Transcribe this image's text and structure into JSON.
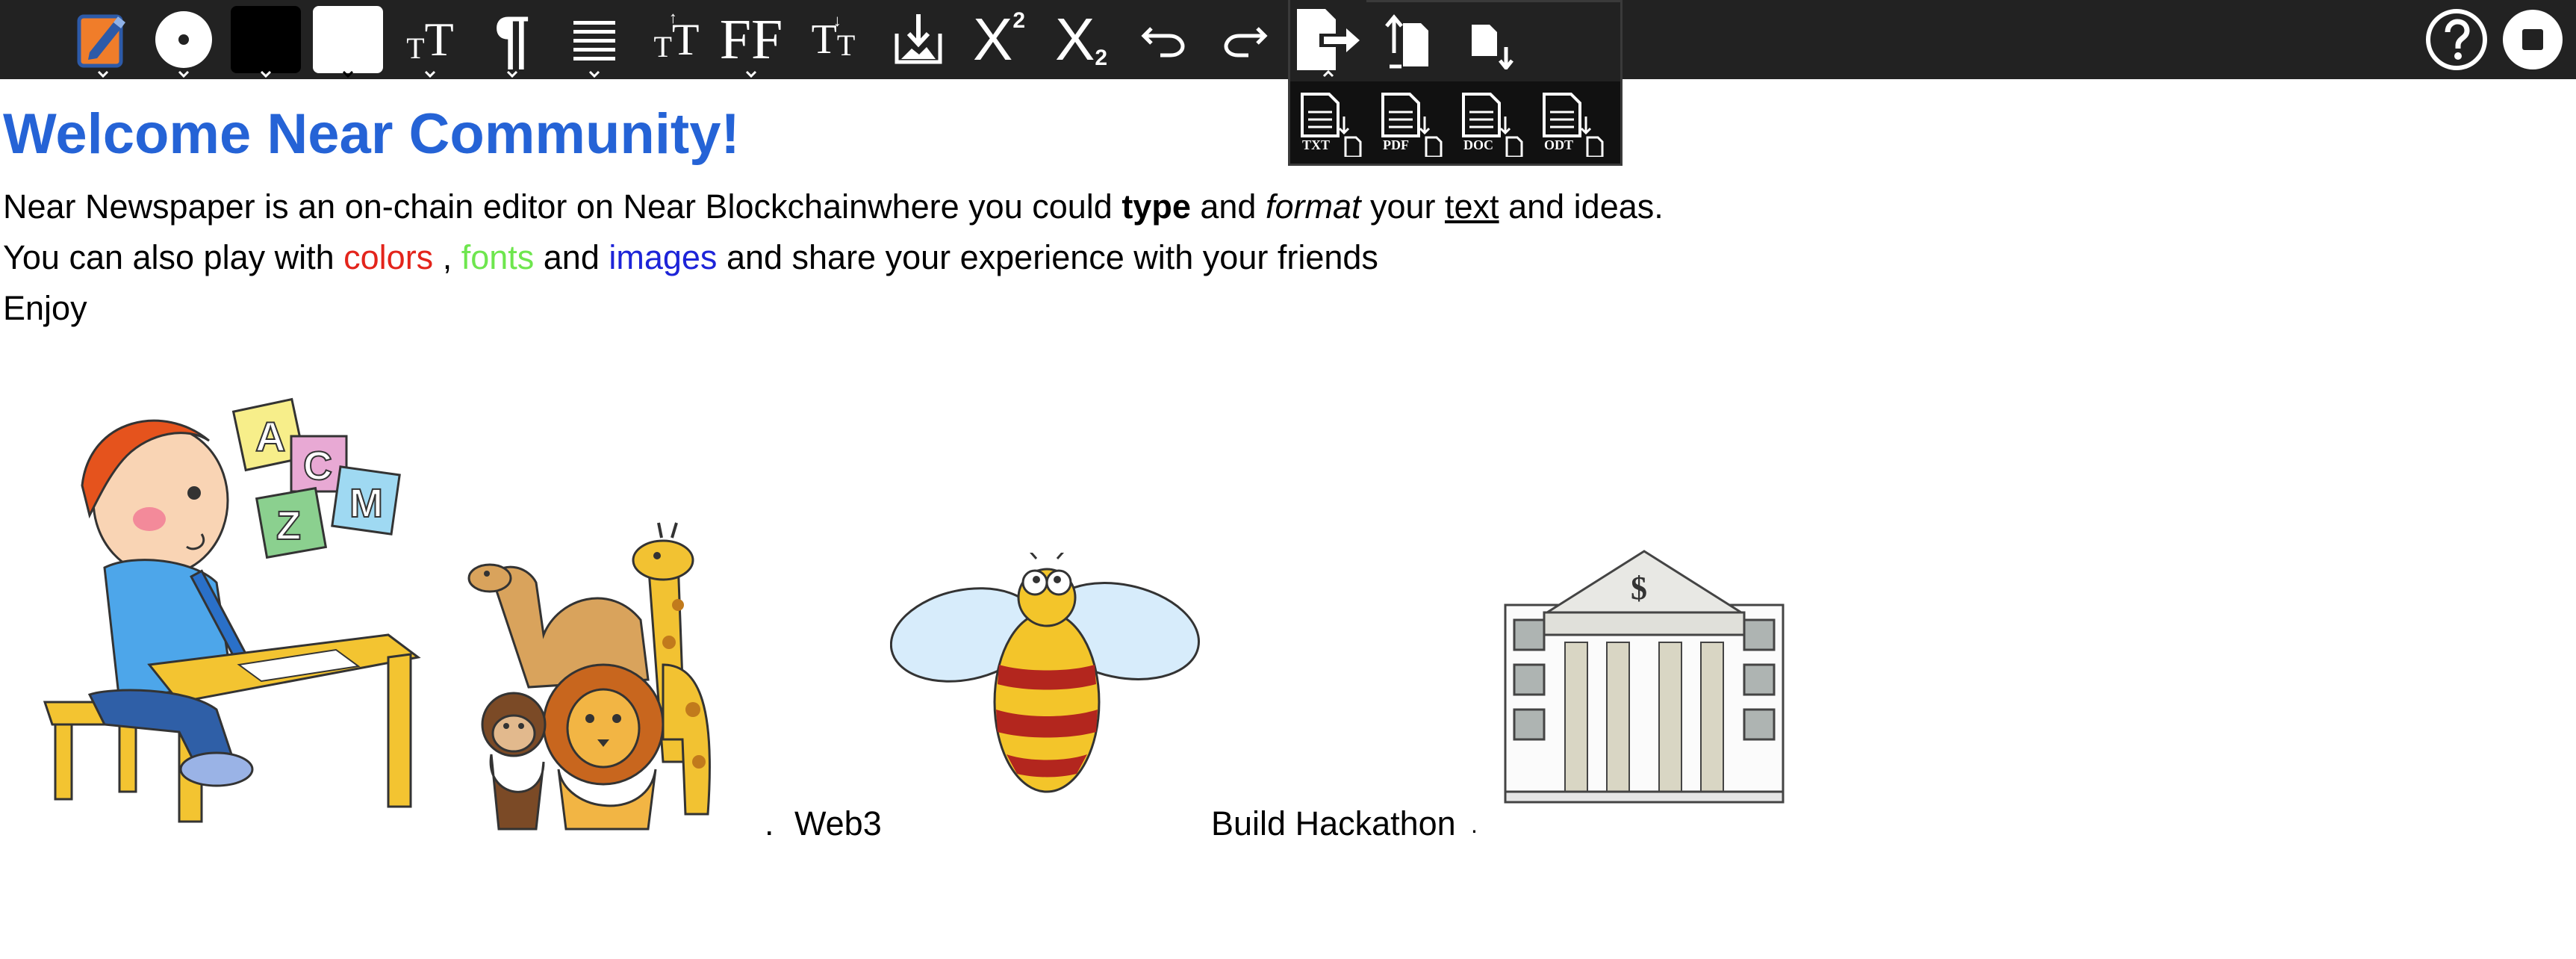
{
  "toolbar": {
    "tools": [
      {
        "icon": "edit-note-icon"
      },
      {
        "icon": "disc-icon"
      },
      {
        "icon": "text-color-swatch-icon",
        "color": "#000000"
      },
      {
        "icon": "background-color-swatch-icon",
        "color": "#ffffff"
      },
      {
        "icon": "font-size-icon",
        "label": "TT"
      },
      {
        "icon": "paragraph-icon",
        "label": "¶"
      },
      {
        "icon": "align-icon"
      },
      {
        "icon": "increase-font-icon",
        "label": "TT"
      },
      {
        "icon": "font-family-icon",
        "label": "FF"
      },
      {
        "icon": "decrease-font-icon",
        "label": "TT"
      },
      {
        "icon": "insert-image-icon"
      },
      {
        "icon": "superscript-icon",
        "label": "X",
        "sup": "2"
      },
      {
        "icon": "subscript-icon",
        "label": "X",
        "sub": "2"
      },
      {
        "icon": "undo-icon"
      },
      {
        "icon": "redo-icon"
      },
      {
        "icon": "export-icon"
      },
      {
        "icon": "import-file-icon"
      },
      {
        "icon": "download-file-icon"
      }
    ],
    "right": [
      {
        "icon": "help-icon"
      },
      {
        "icon": "stop-icon"
      }
    ]
  },
  "export_menu": {
    "items": [
      {
        "label": "TXT",
        "icon": "export-txt-icon"
      },
      {
        "label": "PDF",
        "icon": "export-pdf-icon"
      },
      {
        "label": "DOC",
        "icon": "export-doc-icon"
      },
      {
        "label": "ODT",
        "icon": "export-odt-icon"
      }
    ]
  },
  "document": {
    "title": "Welcome Near Community!",
    "line1": {
      "a": "Near Newspaper is an on-chain editor on Near Blockchainwhere you could ",
      "b": "type",
      "c": " and ",
      "d": "format",
      "e": " your ",
      "f": "text",
      "g": " and ideas."
    },
    "line2": {
      "a": "You can also play with ",
      "colors": "colors",
      "b": " , ",
      "fonts": "fonts",
      "c": " and ",
      "images": "images",
      "d": " and share your experience with your friends"
    },
    "line3": "Enjoy",
    "captions": {
      "dot1": ".",
      "web3": "Web3",
      "build": "Build Hackathon",
      "dot2": "."
    },
    "accent_colors": {
      "title": "#2563d6",
      "red": "#e3241b",
      "green": "#6ee64e",
      "blue": "#1d24d8"
    }
  }
}
